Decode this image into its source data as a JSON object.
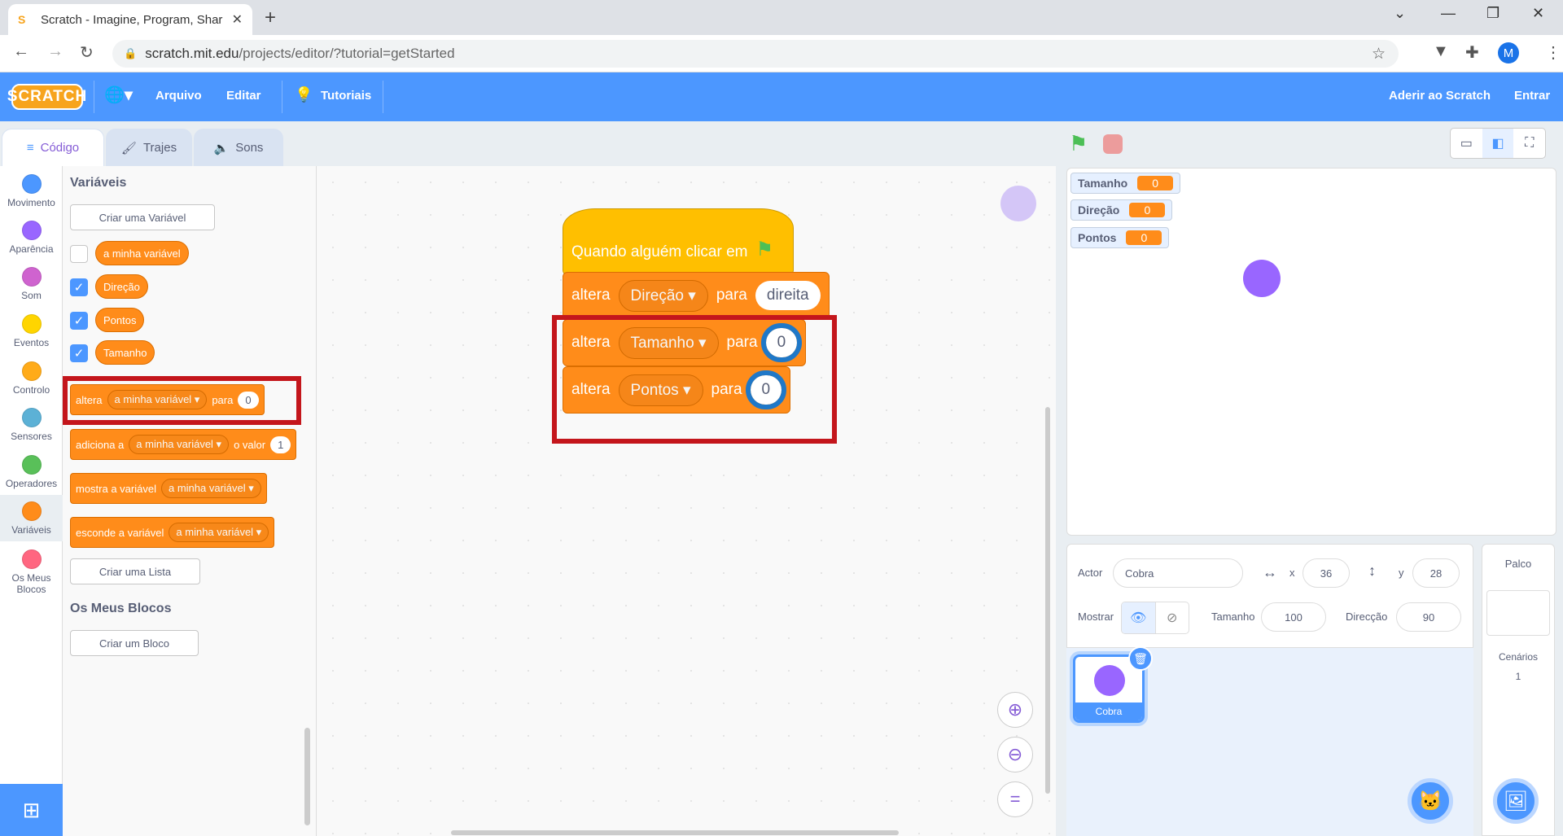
{
  "browser": {
    "tab_title": "Scratch - Imagine, Program, Shar",
    "url_host": "scratch.mit.edu",
    "url_path": "/projects/editor/?tutorial=getStarted",
    "avatar_letter": "M"
  },
  "menubar": {
    "logo": "SCRATCH",
    "file": "Arquivo",
    "edit": "Editar",
    "tutorials": "Tutoriais",
    "join": "Aderir ao Scratch",
    "signin": "Entrar"
  },
  "tabs": {
    "code": "Código",
    "costumes": "Trajes",
    "sounds": "Sons"
  },
  "categories": [
    {
      "label": "Movimento",
      "color": "#4c97ff"
    },
    {
      "label": "Aparência",
      "color": "#9966ff"
    },
    {
      "label": "Som",
      "color": "#cf63cf"
    },
    {
      "label": "Eventos",
      "color": "#ffd500"
    },
    {
      "label": "Controlo",
      "color": "#ffab19"
    },
    {
      "label": "Sensores",
      "color": "#5cb1d6"
    },
    {
      "label": "Operadores",
      "color": "#59c059"
    },
    {
      "label": "Variáveis",
      "color": "#ff8c1a"
    },
    {
      "label1": "Os Meus",
      "label2": "Blocos",
      "color": "#ff6680"
    }
  ],
  "palette": {
    "heading": "Variáveis",
    "create_var": "Criar uma Variável",
    "vars": [
      "a minha variável",
      "Direção",
      "Pontos",
      "Tamanho"
    ],
    "set_block": {
      "text": "altera",
      "var": "a minha variável",
      "to": "para",
      "value": "0"
    },
    "change_block": {
      "text": "adiciona a",
      "var": "a minha variável",
      "by": "o valor",
      "value": "1"
    },
    "show_block": {
      "text": "mostra a variável",
      "var": "a minha variável"
    },
    "hide_block": {
      "text": "esconde a variável",
      "var": "a minha variável"
    },
    "create_list": "Criar uma Lista",
    "myblocks_heading": "Os Meus Blocos",
    "create_block": "Criar um Bloco"
  },
  "script": {
    "hat": "Quando alguém clicar em",
    "blocks": [
      {
        "text": "altera",
        "var": "Direção",
        "to": "para",
        "value": "direita"
      },
      {
        "text": "altera",
        "var": "Tamanho",
        "to": "para",
        "value": "0"
      },
      {
        "text": "altera",
        "var": "Pontos",
        "to": "para",
        "value": "0"
      }
    ]
  },
  "monitors": [
    {
      "name": "Tamanho",
      "value": "0"
    },
    {
      "name": "Direção",
      "value": "0"
    },
    {
      "name": "Pontos",
      "value": "0"
    }
  ],
  "sprite_info": {
    "actor_label": "Actor",
    "actor_name": "Cobra",
    "x_label": "x",
    "x": "36",
    "y_label": "y",
    "y": "28",
    "show_label": "Mostrar",
    "size_label": "Tamanho",
    "size": "100",
    "direction_label": "Direcção",
    "direction": "90"
  },
  "sprites": [
    {
      "name": "Cobra"
    }
  ],
  "stage_panel": {
    "title": "Palco",
    "backdrops_label": "Cenários",
    "backdrops_count": "1"
  },
  "colors": {
    "accent": "#4c97ff",
    "variables": "#ff8c1a",
    "highlight_red": "#c4161c",
    "highlight_blue": "#1f78c8",
    "sprite": "#9966ff"
  }
}
